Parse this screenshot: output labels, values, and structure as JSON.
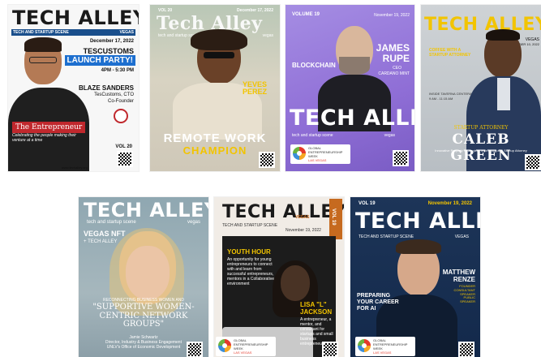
{
  "covers": [
    {
      "brand": "TECH ALLEY",
      "tagline": "TECH AND STARTUP SCENE",
      "city": "VEGAS",
      "date": "December 17, 2022",
      "headline1": "TESCUSTOMS",
      "headline2": "LAUNCH PARTY!",
      "time": "4PM - 5:30 PM",
      "person_name": "BLAZE SANDERS",
      "person_role1": "TesCustoms, CTO",
      "person_role2": "Co-Founder",
      "section": "The Entrepreneur",
      "quote": "Celebrating the people making their venture at a time",
      "vol": "VOL 20",
      "url": "www.techalley.org"
    },
    {
      "vol": "VOL 20",
      "date": "December 17, 2022",
      "brand": "Tech Alley",
      "tagline": "tech and startup scene",
      "city": "vegas",
      "person_name": "YEVES PEREZ",
      "headline1": "REMOTE WORK",
      "headline2": "CHAMPION"
    },
    {
      "volume": "VOLUME 19",
      "date": "November 19, 2022",
      "person_first": "JAMES",
      "person_last": "RUPE",
      "role1": "CEO",
      "role2": "CARDANO MINT",
      "section": "BLOCKCHAIN",
      "brand": "TECH ALLEY",
      "tagline": "tech and startup scene",
      "city": "vegas",
      "gem_line1": "GLOBAL",
      "gem_line2": "ENTREPRENEURSHIP",
      "gem_line3": "WEEK",
      "gem_line4": "LAS VEGAS"
    },
    {
      "brand": "TECH ALLEY",
      "city": "VEGAS",
      "date": "SEPTEMBER 10, 2022",
      "section": "COFFEE WITH A STARTUP ATTORNEY",
      "event": "INSIDE TAVERNA CENTERA",
      "time": "9 AM - 11:15 AM",
      "kicker": "STARTUP ATTORNEY",
      "person_name": "CALEB GREEN",
      "footer": "Innovative Property Strategies, Technology and Startup Attorney"
    },
    {
      "brand": "TECH ALLEY",
      "tagline": "tech and startup scene",
      "city": "vegas",
      "section": "VEGAS NFT",
      "section2": "+ TECH ALLEY",
      "kicker": "RECONNECTING BUSINESS WOMEN AND",
      "headline": "\"SUPPORTIVE WOMEN-CENTRIC NETWORK GROUPS\"",
      "person_name": "Jamie Schwartz",
      "role1": "Director, Industry & Business Engagement",
      "role2": "UNLV's Office of Economic Development"
    },
    {
      "brand": "TECH ALLEY",
      "tagline": "TECH AND STARTUP SCENE",
      "city": "VEGAS",
      "vol": "VOL 19",
      "date": "November 19, 2022",
      "section": "YOUTH HOUR",
      "blurb": "An opportunity for young entrepreneurs to connect with and learn from successful entrepreneurs, mentors in a Collaborative environment",
      "person_name1": "LISA \"L\"",
      "person_name2": "JACKSON",
      "person_desc": "A entrepreneur, a mentor, and consultant for startups and small business entrepreneurs.",
      "gem_line1": "GLOBAL",
      "gem_line2": "ENTREPRENEURSHIP",
      "gem_line3": "WEEK",
      "gem_line4": "LAS VEGAS"
    },
    {
      "vol": "VOL 19",
      "date": "November 19, 2022",
      "brand": "TECH ALLEY",
      "tagline": "TECH AND STARTUP SCENE",
      "city": "VEGAS",
      "person_first": "MATTHEW",
      "person_last": "RENZE",
      "role": "FOUNDER CONSULTANT SPEAKER PUBLIC SPEAKER",
      "headline1": "PREPARING",
      "headline2": "YOUR CAREER",
      "headline3": "FOR AI",
      "gem_line1": "GLOBAL",
      "gem_line2": "ENTREPRENEURSHIP",
      "gem_line3": "WEEK",
      "gem_line4": "LAS VEGAS"
    }
  ],
  "colors": {
    "brand_blue": "#1a4f8c",
    "launch_blue": "#1d6fcf",
    "entrepreneur_red": "#c0282d",
    "champion_yellow": "#f2c400",
    "purple": "#8f6ed6",
    "navy": "#13294b"
  }
}
